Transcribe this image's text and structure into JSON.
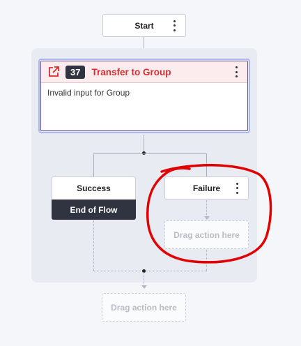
{
  "start": {
    "label": "Start"
  },
  "action": {
    "number": "37",
    "title": "Transfer to Group",
    "description": "Invalid input for Group"
  },
  "branches": {
    "success": {
      "label": "Success",
      "end_label": "End of Flow"
    },
    "failure": {
      "label": "Failure",
      "dropzone": "Drag action here"
    }
  },
  "bottom_dropzone": "Drag action here",
  "colors": {
    "accent_red": "#d32f2f",
    "badge_bg": "#2f3440",
    "end_of_flow_bg": "#2f3440",
    "group_bg": "#e9ebf3",
    "selection_blue": "#a9b9f0",
    "annotation_circle": "#e00000"
  },
  "icons": {
    "external_link": "external-link-icon",
    "more": "kebab-menu-icon"
  }
}
